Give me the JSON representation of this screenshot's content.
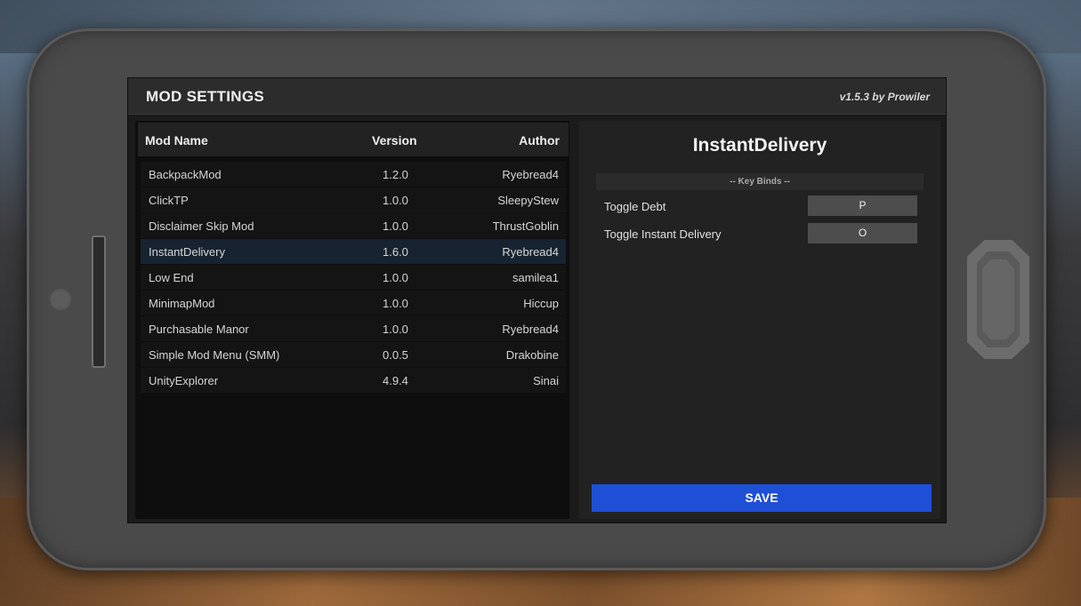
{
  "header": {
    "title": "MOD SETTINGS",
    "version": "v1.5.3 by Prowiler"
  },
  "table": {
    "columns": [
      "Mod Name",
      "Version",
      "Author"
    ],
    "rows": [
      {
        "name": "BackpackMod",
        "version": "1.2.0",
        "author": "Ryebread4"
      },
      {
        "name": "ClickTP",
        "version": "1.0.0",
        "author": "SleepyStew"
      },
      {
        "name": "Disclaimer Skip Mod",
        "version": "1.0.0",
        "author": "ThrustGoblin"
      },
      {
        "name": "InstantDelivery",
        "version": "1.6.0",
        "author": "Ryebread4"
      },
      {
        "name": "Low End",
        "version": "1.0.0",
        "author": "samilea1"
      },
      {
        "name": "MinimapMod",
        "version": "1.0.0",
        "author": "Hiccup"
      },
      {
        "name": "Purchasable Manor",
        "version": "1.0.0",
        "author": "Ryebread4"
      },
      {
        "name": "Simple Mod Menu (SMM)",
        "version": "0.0.5",
        "author": "Drakobine"
      },
      {
        "name": "UnityExplorer",
        "version": "4.9.4",
        "author": "Sinai"
      }
    ],
    "selected_index": 3
  },
  "detail": {
    "title": "InstantDelivery",
    "section_label": "-- Key Binds --",
    "keybinds": [
      {
        "label": "Toggle Debt",
        "key": "P"
      },
      {
        "label": "Toggle Instant Delivery",
        "key": "O"
      }
    ],
    "save_label": "SAVE"
  },
  "colors": {
    "save_button": "#1f4fd6",
    "selected_row": "#172330"
  }
}
